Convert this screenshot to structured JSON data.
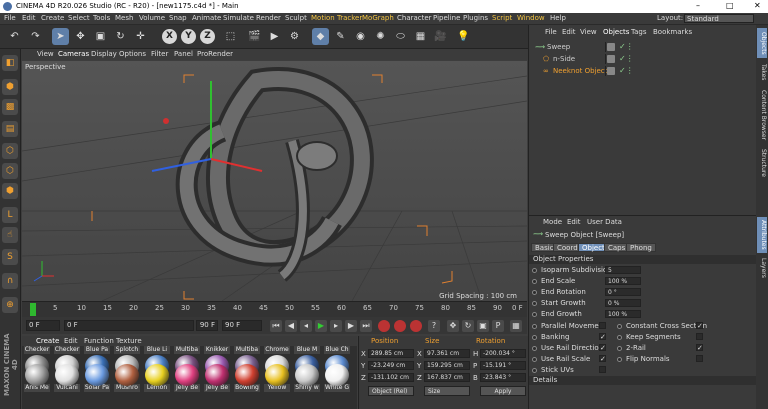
{
  "window": {
    "title": "CINEMA 4D R20.026 Studio (RC - R20) - [new1175.c4d *] - Main",
    "controls": [
      "–",
      "□",
      "✕"
    ]
  },
  "menu": [
    "File",
    "Edit",
    "Create",
    "Select",
    "Tools",
    "Mesh",
    "Volume",
    "Snap",
    "Animate",
    "Simulate",
    "Render",
    "Sculpt",
    "Motion Tracker",
    "MoGraph",
    "Character",
    "Pipeline",
    "Plugins",
    "Script",
    "Window",
    "Help"
  ],
  "layout": {
    "label": "Layout:",
    "value": "Standard"
  },
  "viewport": {
    "menu": [
      "View",
      "Cameras",
      "Display",
      "Options",
      "Filter",
      "Panel",
      "ProRender"
    ],
    "label": "Perspective",
    "grid_spacing": "Grid Spacing : 100 cm"
  },
  "timeline": {
    "ticks": [
      "0",
      "5",
      "10",
      "15",
      "20",
      "25",
      "30",
      "35",
      "40",
      "45",
      "50",
      "55",
      "60",
      "65",
      "70",
      "75",
      "80",
      "85",
      "90"
    ],
    "end_label": "0 F"
  },
  "playback": {
    "start": "0 F",
    "current": "0 F",
    "range_end": "90 F",
    "end": "90 F"
  },
  "materials": {
    "menu": [
      "Create",
      "Edit",
      "Function",
      "Texture"
    ],
    "row1": [
      "Checker",
      "Checker",
      "Blue Pa",
      "Splotch",
      "Blue Li",
      "Multiba",
      "Knikker",
      "Multiba",
      "Chrome",
      "Blue M",
      "Blue Ch"
    ],
    "row2": [
      "Anis Me",
      "Vulcani",
      "Solar Pa",
      "Mushro",
      "Lemon",
      "Jelly Be",
      "Jelly Be",
      "Bowling",
      "Yellow",
      "Shiny w",
      "White G"
    ],
    "row1_colors": [
      "#8a8a8a",
      "#cfcfcf",
      "#3a6fb5",
      "#b8b8b8",
      "#4a7fc5",
      "#7a5080",
      "#9a5ab0",
      "#7a6090",
      "#d8d8d8",
      "#3a5fa0",
      "#5a8ad0"
    ],
    "row2_colors": [
      "#a0a0a0",
      "#e0e0e0",
      "#6a9ae0",
      "#b06040",
      "#e8d020",
      "#e04080",
      "#c03070",
      "#d04030",
      "#e8c020",
      "#c8c8c8",
      "#f0f0f0"
    ]
  },
  "coordinates": {
    "headers": [
      "Position",
      "Size",
      "Rotation"
    ],
    "rows": [
      {
        "axis": "X",
        "pos": "289.85 cm",
        "s": "X",
        "size": "97.361 cm",
        "r": "H",
        "rot": "-200.034 °"
      },
      {
        "axis": "Y",
        "pos": "-23.249 cm",
        "s": "Y",
        "size": "159.295 cm",
        "r": "P",
        "rot": "-15.191 °"
      },
      {
        "axis": "Z",
        "pos": "-131.102 cm",
        "s": "Z",
        "size": "167.837 cm",
        "r": "B",
        "rot": "-23.843 °"
      }
    ],
    "mode": "Object (Rel)",
    "size_mode": "Size",
    "apply": "Apply"
  },
  "objects": {
    "menu": [
      "File",
      "Edit",
      "View",
      "Objects",
      "Tags",
      "Bookmarks"
    ],
    "items": [
      {
        "name": "Sweep",
        "color": "#8fd18f"
      },
      {
        "name": "n-Side",
        "color": "#f0a030"
      },
      {
        "name": "Neeknot Object",
        "color": "#f0a030"
      }
    ]
  },
  "attributes": {
    "menu": [
      "Mode",
      "Edit",
      "User Data"
    ],
    "header": "Sweep Object [Sweep]",
    "tabs": [
      "Basic",
      "Coord",
      "Object",
      "Caps",
      "Phong"
    ],
    "section": "Object Properties",
    "props": [
      {
        "label": "Isoparm Subdivision",
        "value": "5"
      },
      {
        "label": "End Scale",
        "value": "100 %"
      },
      {
        "label": "End Rotation",
        "value": "0 °"
      },
      {
        "label": "Start Growth",
        "value": "0 %"
      },
      {
        "label": "End Growth",
        "value": "100 %"
      }
    ],
    "checks_left": [
      {
        "label": "Parallel Movement",
        "value": ""
      },
      {
        "label": "Banking",
        "value": "✓"
      },
      {
        "label": "Use Rail Direction",
        "value": "✓"
      },
      {
        "label": "Use Rail Scale",
        "value": "✓"
      },
      {
        "label": "Stick UVs",
        "value": ""
      }
    ],
    "checks_right": [
      {
        "label": "Constant Cross Section",
        "value": "✓"
      },
      {
        "label": "Keep Segments",
        "value": ""
      },
      {
        "label": "2-Rail",
        "value": "✓"
      },
      {
        "label": "Flip Normals",
        "value": ""
      }
    ],
    "details": "Details"
  },
  "right_tabs": [
    "Objects",
    "Takes",
    "Content Browser",
    "Structure",
    "Attributes",
    "Layers"
  ],
  "brand": "MAXON CINEMA 4D"
}
